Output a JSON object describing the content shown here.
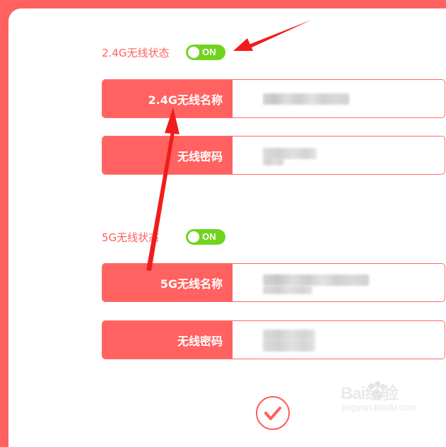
{
  "band_24g": {
    "status_label": "2.4G无线状态",
    "toggle_label": "ON",
    "ssid_label": "2.4G无线名称",
    "password_label": "无线密码"
  },
  "band_5g": {
    "status_label": "5G无线状态",
    "toggle_label": "ON",
    "ssid_label": "5G无线名称",
    "password_label": "无线密码"
  },
  "watermark": {
    "brand": "Bai经验",
    "url": "jingyan.baidu.com"
  },
  "colors": {
    "accent": "#ff6260",
    "toggle_on": "#70d41f",
    "arrow": "#f01c1c"
  },
  "icons": {
    "submit": "checkmark-icon",
    "watermark": "baidu-paw-icon"
  }
}
